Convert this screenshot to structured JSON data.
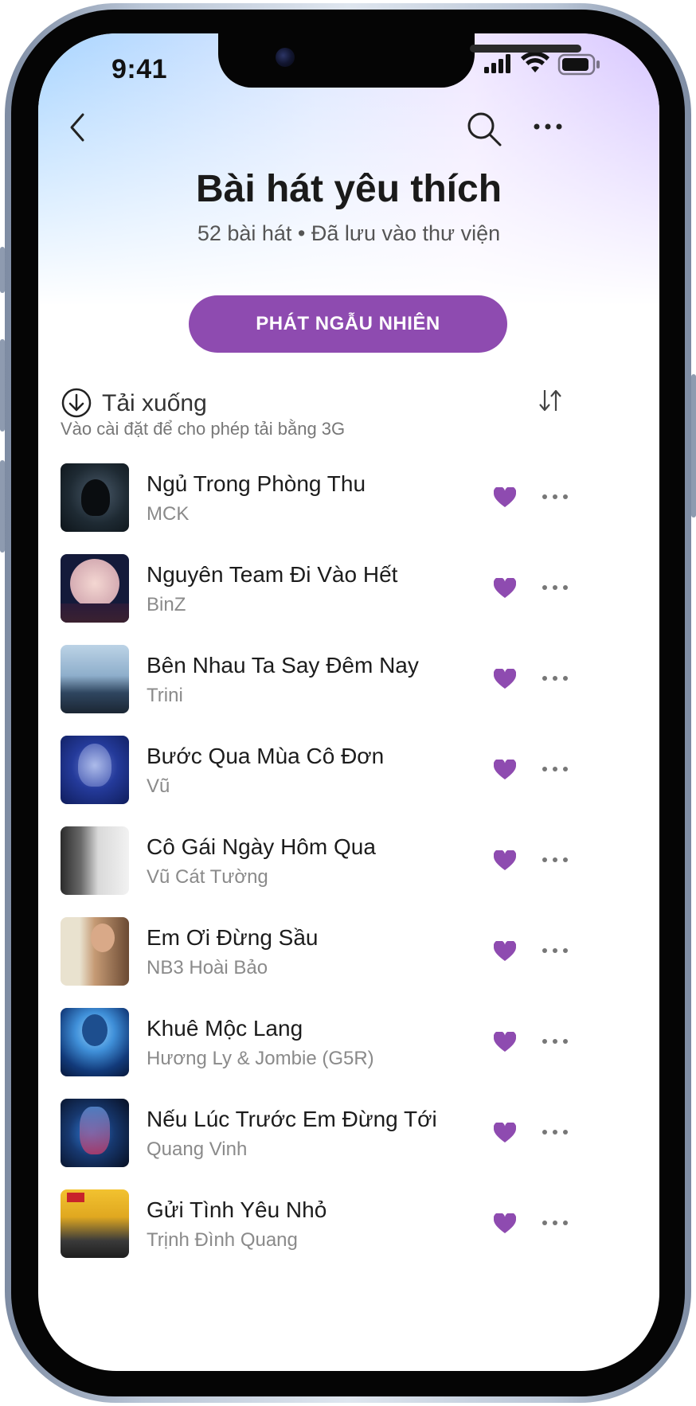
{
  "status": {
    "time": "9:41"
  },
  "header": {
    "title": "Bài hát yêu thích",
    "subtitle": "52 bài hát • Đã lưu vào thư viện",
    "shuffle_label": "PHÁT NGẪU NHIÊN"
  },
  "download": {
    "label": "Tải xuống",
    "hint": "Vào cài đặt để cho phép tải bằng 3G"
  },
  "colors": {
    "accent": "#8e4bb0",
    "heart": "#8e4bb0"
  },
  "songs": [
    {
      "title": "Ngủ Trong Phòng Thu",
      "artist": "MCK"
    },
    {
      "title": "Nguyên Team Đi Vào Hết",
      "artist": "BinZ"
    },
    {
      "title": "Bên Nhau Ta Say Đêm Nay",
      "artist": "Trini"
    },
    {
      "title": "Bước Qua Mùa Cô Đơn",
      "artist": "Vũ"
    },
    {
      "title": "Cô Gái Ngày Hôm Qua",
      "artist": "Vũ Cát Tường"
    },
    {
      "title": "Em Ơi Đừng Sầu",
      "artist": "NB3 Hoài Bảo"
    },
    {
      "title": "Khuê Mộc Lang",
      "artist": "Hương Ly & Jombie (G5R)"
    },
    {
      "title": "Nếu Lúc Trước Em Đừng Tới",
      "artist": "Quang Vinh"
    },
    {
      "title": "Gửi Tình Yêu Nhỏ",
      "artist": "Trịnh Đình Quang"
    }
  ]
}
